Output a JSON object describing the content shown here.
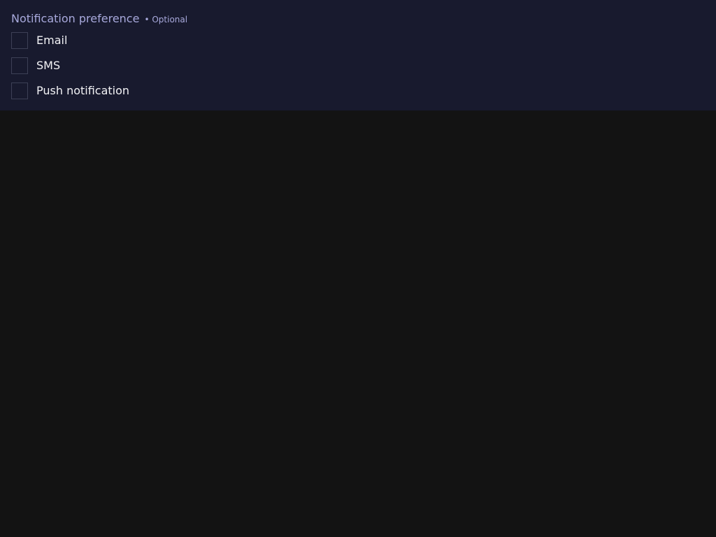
{
  "form": {
    "legend": "Notification preference",
    "optional_label": "• Optional",
    "options": [
      {
        "label": "Email",
        "checked": false
      },
      {
        "label": "SMS",
        "checked": false
      },
      {
        "label": "Push notification",
        "checked": false
      }
    ]
  },
  "colors": {
    "page_background": "#131313",
    "panel_background": "#181a2e",
    "legend_text": "#a8a9dc",
    "option_text": "#f2f2f5",
    "checkbox_border": "#3d4056"
  }
}
